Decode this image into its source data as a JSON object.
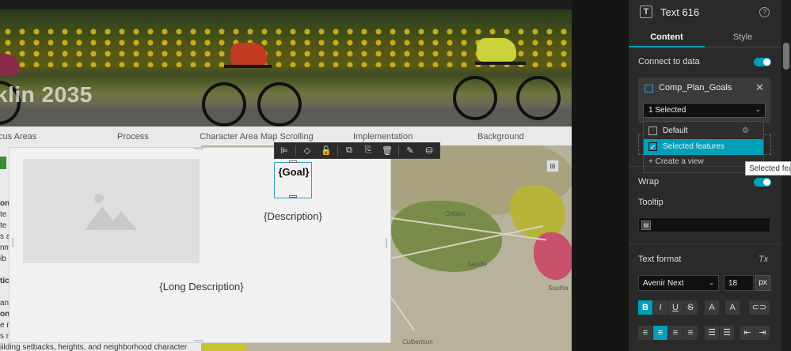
{
  "hero": {
    "title": "klin 2035"
  },
  "nav": {
    "items": [
      "cus Areas",
      "Process",
      "Character Area Map Scrolling",
      "Implementation",
      "Background"
    ]
  },
  "left_text": {
    "lines": [
      "on",
      "te",
      "te",
      "s a",
      "nm",
      "ib",
      "tic",
      "an",
      "on",
      "e r",
      "s r",
      "iilding setbacks, heights, and neighborhood character"
    ]
  },
  "map": {
    "labels": [
      "Ortown",
      "Saddle",
      "Southa",
      "Culbertson"
    ],
    "tool_label": "⊞"
  },
  "card": {
    "goal": "{Goal}",
    "description": "{Description}",
    "long_description": "{Long Description}"
  },
  "toolbar": {
    "align": "⊫",
    "layers": "◇",
    "lock": "🔓",
    "duplicate": "⧉",
    "save": "⎘",
    "delete": "🗑",
    "edit": "✎",
    "data": "⛁"
  },
  "panel": {
    "widget_title": "Text 616",
    "widget_icon": "T",
    "help": "?",
    "tabs": {
      "content": "Content",
      "style": "Style"
    },
    "connect_to_data": "Connect to data",
    "datasource": {
      "name": "Comp_Plan_Goals",
      "close": "✕",
      "selected_value": "1 Selected",
      "chevron": "⌄"
    },
    "views": {
      "default_label": "Default",
      "selected_label": "Selected features",
      "create_label": "+ Create a view",
      "check": "✓",
      "gear": "⚙"
    },
    "tooltip_popup": "Selected features",
    "wrap": "Wrap",
    "tooltip": "Tooltip",
    "tooltip_icon": "▤",
    "text_format": "Text format",
    "clear_format": "Tx",
    "font_family": "Avenir Next",
    "font_chevron": "⌄",
    "font_size": "18",
    "unit": "px",
    "format_buttons": [
      "B",
      "I",
      "U",
      "S",
      "A",
      "A",
      "⊂⊃"
    ],
    "align_buttons": [
      "≡",
      "≡",
      "≡",
      "≡",
      "☰",
      "☰",
      "⇤",
      "⇥"
    ]
  },
  "colors": {
    "accent": "#00a0b8",
    "panel_bg": "#2a2a2a",
    "canvas_bg": "#1c1c1c"
  }
}
